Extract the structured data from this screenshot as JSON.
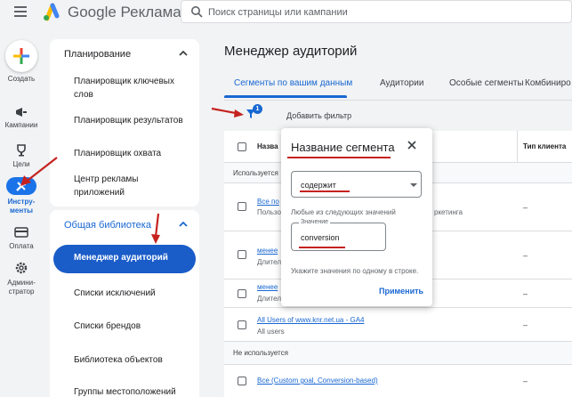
{
  "header": {
    "brand": "Google Реклама",
    "search_placeholder": "Поиск страницы или кампании"
  },
  "rail": {
    "create": "Создать",
    "campaigns": "Кампании",
    "goals": "Цели",
    "tools": "Инстру-\nменты",
    "billing": "Оплата",
    "admin": "Админи-\nстратор"
  },
  "sidebar": {
    "planning_title": "Планирование",
    "planning_items": [
      "Планировщик ключевых слов",
      "Планировщик результатов",
      "Планировщик охвата",
      "Центр рекламы приложений"
    ],
    "library_title": "Общая библиотека",
    "library_items": [
      "Менеджер аудиторий",
      "Списки исключений",
      "Списки брендов",
      "Библиотека объектов",
      "Группы местоположений"
    ]
  },
  "main": {
    "title": "Менеджер аудиторий",
    "tabs": [
      "Сегменты по вашим данным",
      "Аудитории",
      "Особые сегменты",
      "Комбиниро"
    ],
    "filter_badge": "1",
    "add_filter": "Добавить фильтр",
    "table": {
      "col_name": "Назва",
      "col_client_type": "Тип клиента",
      "group_used": "Используется",
      "group_unused": "Не используется",
      "rows": [
        {
          "link": "Все по",
          "sub": "Пользо",
          "extra": "ркетинга",
          "client": "–"
        },
        {
          "link": "менее",
          "sub": "Длител",
          "client": "–"
        },
        {
          "link": "менее",
          "sub": "Длител",
          "client": "–"
        },
        {
          "link": "All Users of www.knr.net.ua - GA4",
          "sub": "All users",
          "client": "–"
        },
        {
          "link": "Все (Custom goal, Conversion-based)",
          "sub": "",
          "client": "–"
        }
      ]
    }
  },
  "popup": {
    "title": "Название сегмента",
    "operator": "содержит",
    "any_of_label": "Любые из следующих значений",
    "value_legend": "Значение",
    "value": "conversion",
    "hint": "Укажите значения по одному в строке.",
    "apply": "Применить"
  },
  "colors": {
    "accent": "#1967d2",
    "active_nav": "#1a5cc8",
    "annotation_red": "#c5221f"
  }
}
